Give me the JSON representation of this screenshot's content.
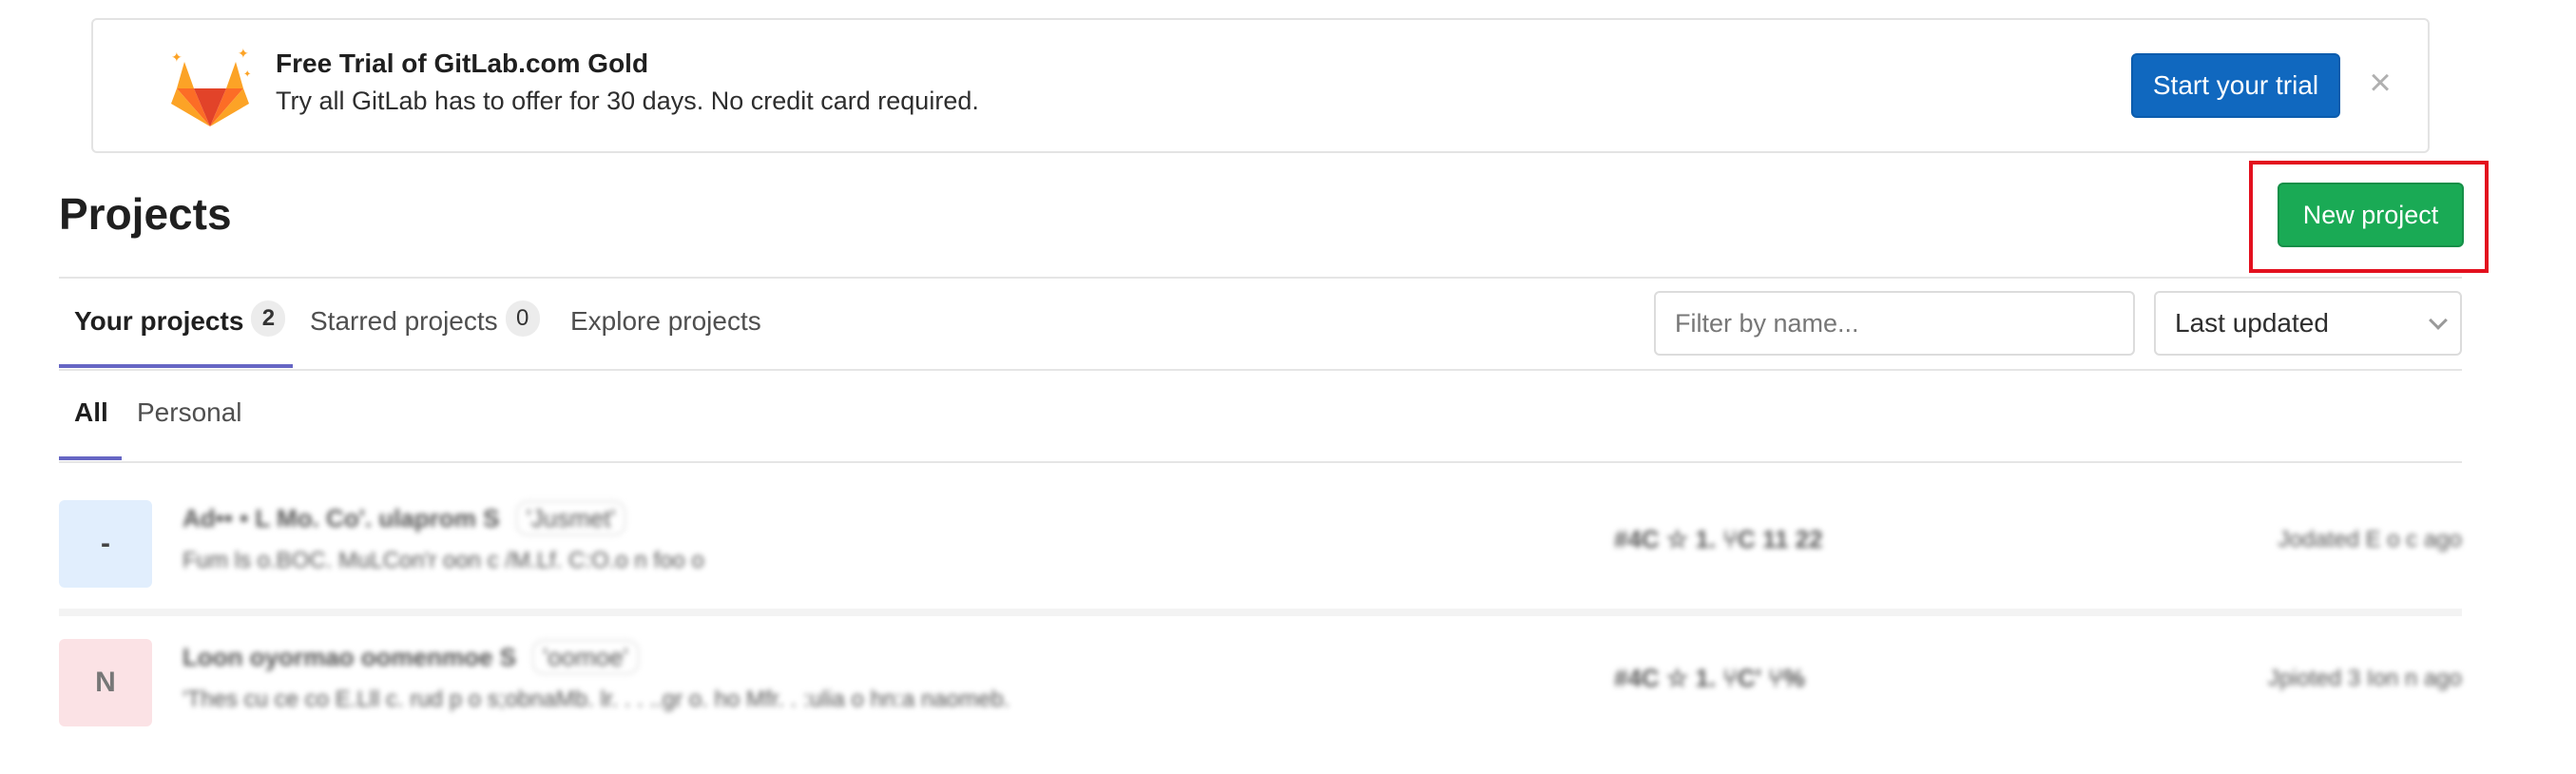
{
  "banner": {
    "title": "Free Trial of GitLab.com Gold",
    "subtitle": "Try all GitLab has to offer for 30 days. No credit card required.",
    "cta_label": "Start your trial",
    "close_glyph": "×",
    "logo_icon": "gitlab-tanuki-icon",
    "colors": {
      "cta": "#1068bf"
    }
  },
  "header": {
    "title": "Projects",
    "new_project_label": "New project",
    "colors": {
      "new_project": "#1aaa55",
      "highlight": "#e3101e"
    }
  },
  "tabs": [
    {
      "label": "Your projects",
      "count": "2"
    },
    {
      "label": "Starred projects",
      "count": "0"
    },
    {
      "label": "Explore projects"
    }
  ],
  "filter": {
    "placeholder": "Filter by name..."
  },
  "sort": {
    "selected": "Last updated"
  },
  "subtabs": [
    {
      "label": "All"
    },
    {
      "label": "Personal"
    }
  ],
  "projects": [
    {
      "avatar_letter": "-",
      "avatar_color": "#e1eefd",
      "name": "Ad•• • L Mo. Co'. ulaprom  S",
      "badge": "'Jusmet'",
      "description": "Fum ls o.BOC. MuLCon'r oon c /M.Lf. C:O.o n foo o",
      "stats": "#4C   ☆ 1.   ⑂C   11 22",
      "updated": "Jodated E  o c   ago"
    },
    {
      "avatar_letter": "N",
      "avatar_color": "#fbe2e5",
      "name": "Loon oyormao oomenmoe  S",
      "badge": "'oomoe'",
      "description": "'Thes cu ce co E.Lll c. rud p o s;obnaMb. lr. . . ..gr o. ho Mfr. . :ulia o hn:a naomeb.",
      "stats": "#4C   ☆ 1.   ⑂C'   ⑂% ",
      "updated": "Jpioted 3 Ion n ago"
    }
  ]
}
